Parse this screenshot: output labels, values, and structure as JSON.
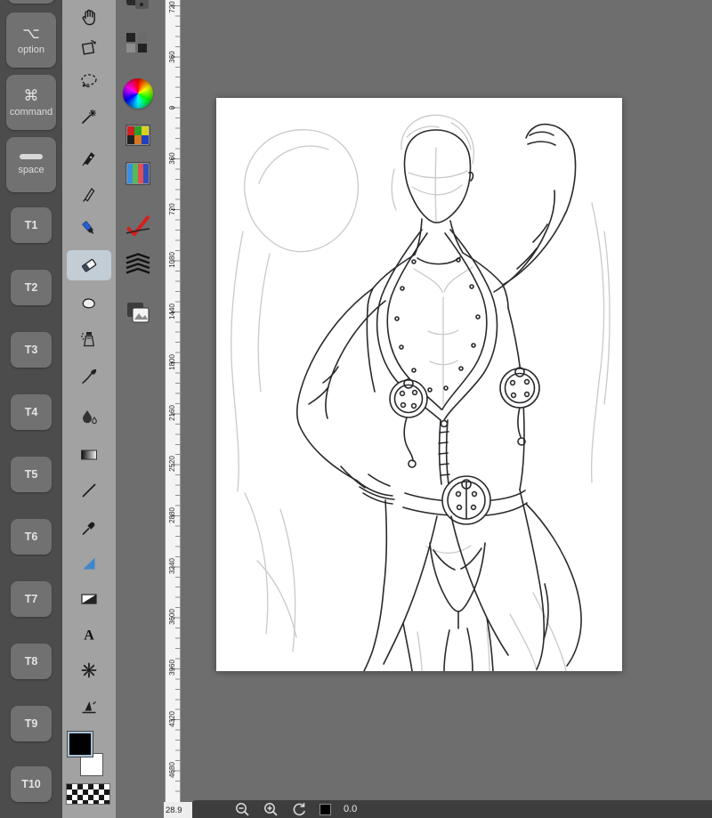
{
  "shortcut_panel": {
    "option": {
      "symbol": "⌥",
      "label": "option"
    },
    "command": {
      "symbol": "⌘",
      "label": "command"
    },
    "space": {
      "label": "space"
    },
    "t_buttons": [
      "T1",
      "T2",
      "T3",
      "T4",
      "T5",
      "T6",
      "T7",
      "T8",
      "T9",
      "T10"
    ]
  },
  "toolbar": {
    "selected_tool": "eraser",
    "text_tool_glyph": "A",
    "tools": [
      "hand",
      "rotate-view",
      "lasso",
      "magic-wand",
      "pen",
      "mapping-pen",
      "marker",
      "eraser",
      "kneaded-eraser",
      "airbrush",
      "paintbrush",
      "blend-drop",
      "gradient",
      "line",
      "eyedropper",
      "fill",
      "tone",
      "text",
      "pattern-spray",
      "perspective-move"
    ]
  },
  "color_swatches": {
    "foreground": "#000000",
    "background": "#ffffff",
    "pattern": "checker"
  },
  "side_panel": {
    "icons": [
      "tone-cards",
      "halftone-dots",
      "color-wheel",
      "color-palette",
      "pattern-palette",
      "auto-correct-check",
      "layer-stack",
      "reference-images"
    ]
  },
  "ruler": {
    "labels": [
      "720",
      "360",
      "0",
      "360",
      "720",
      "1080",
      "1440",
      "1800",
      "2160",
      "2520",
      "2880",
      "3240",
      "3600",
      "3960",
      "4320",
      "4680"
    ]
  },
  "status_bar": {
    "readout": "28.9",
    "icons": [
      "zoom-out",
      "zoom-in",
      "rotate-view"
    ],
    "swatch_color": "#000000",
    "rotation_value": "0.0"
  },
  "colors": {
    "workspace_bg": "#6e6e6e",
    "shortcut_panel_bg": "#4c4c4c",
    "tool_column_bg": "#a2a2a2",
    "selected_tool_bg": "#c2cdd5",
    "canvas_bg": "#ffffff",
    "status_bar_bg": "#3d3d3d"
  }
}
